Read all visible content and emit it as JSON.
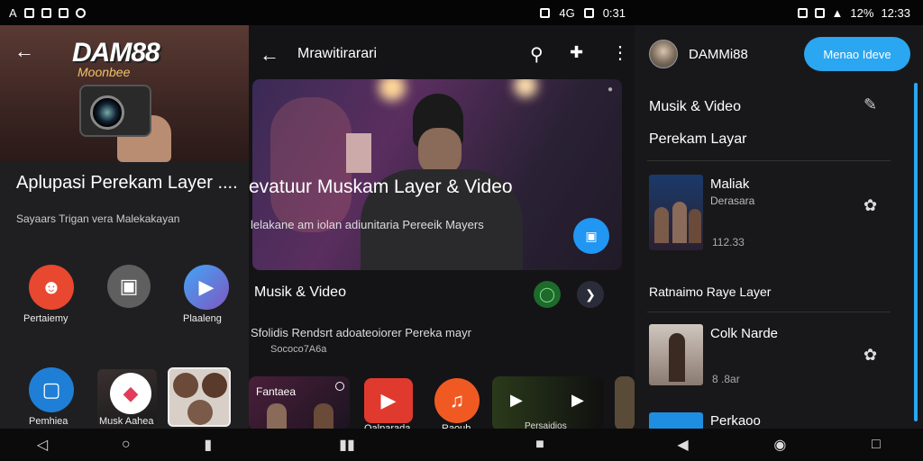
{
  "panel1": {
    "status_left": "A",
    "logo": "DAM88",
    "logo_sub": "Moonbee",
    "title": "Aplupasi Perekam Layer ....",
    "subtitle": "Sayaars Trigan vera Malekakayan",
    "apps": [
      {
        "label": "Pertaiemy",
        "icon": "person-icon",
        "color": "#e8482f"
      },
      {
        "label": "",
        "icon": "screen-record-icon",
        "color": "#5f5f5f"
      },
      {
        "label": "Plaaleng",
        "icon": "play-icon",
        "color": "#4a7be8"
      },
      {
        "label": "Pemhiea",
        "icon": "edit-icon",
        "color": "#1f7fd6"
      },
      {
        "label": "Musk Aahea",
        "icon": "stack-icon",
        "color": "#ffffff"
      },
      {
        "label": "",
        "icon": "photo-icon",
        "color": "#cccccc"
      }
    ]
  },
  "panel2": {
    "status_time": "0:31",
    "status_icons": "4G",
    "header_title": "Mrawitirarari",
    "hero_title": "evatuur Muskam Layer & Video",
    "hero_subtitle": "lelakane am iolan adiunitaria Pereeik Mayers",
    "fab_label": "▣",
    "section_title": "Musik & Video",
    "description": "Sfolidis Rendsrt adoateoiorer Pereka mayr",
    "meta": "Sococo7A6a",
    "tiles": [
      {
        "label": "Fantaea",
        "kind": "photo"
      },
      {
        "label": "Oalparada",
        "kind": "video-icon",
        "color": "#e03a2f"
      },
      {
        "label": "Raoub",
        "kind": "music-icon",
        "color": "#f05a22"
      },
      {
        "label": "Persaidios",
        "kind": "video-thumb"
      }
    ]
  },
  "panel3": {
    "status_battery": "12%",
    "status_time": "12:33",
    "username": "DAMMi88",
    "action_button": "Menao Ideve",
    "heading1": "Musik & Video",
    "heading2": "Perekam Layar",
    "items": [
      {
        "title": "Maliak",
        "subtitle": "Derasara",
        "meta": "112.33 ",
        "thumb": "people"
      },
      {
        "title": "Colk Narde",
        "subtitle": "",
        "meta": "8 .8ar",
        "thumb": "guitar"
      },
      {
        "title": "Perkaoo",
        "subtitle": "",
        "meta": "",
        "thumb": "blue"
      }
    ],
    "section2": "Ratnaimo Raye Layer"
  },
  "colors": {
    "accent": "#2ba6f0",
    "fab": "#2196f3",
    "dark_bg": "#141416"
  }
}
